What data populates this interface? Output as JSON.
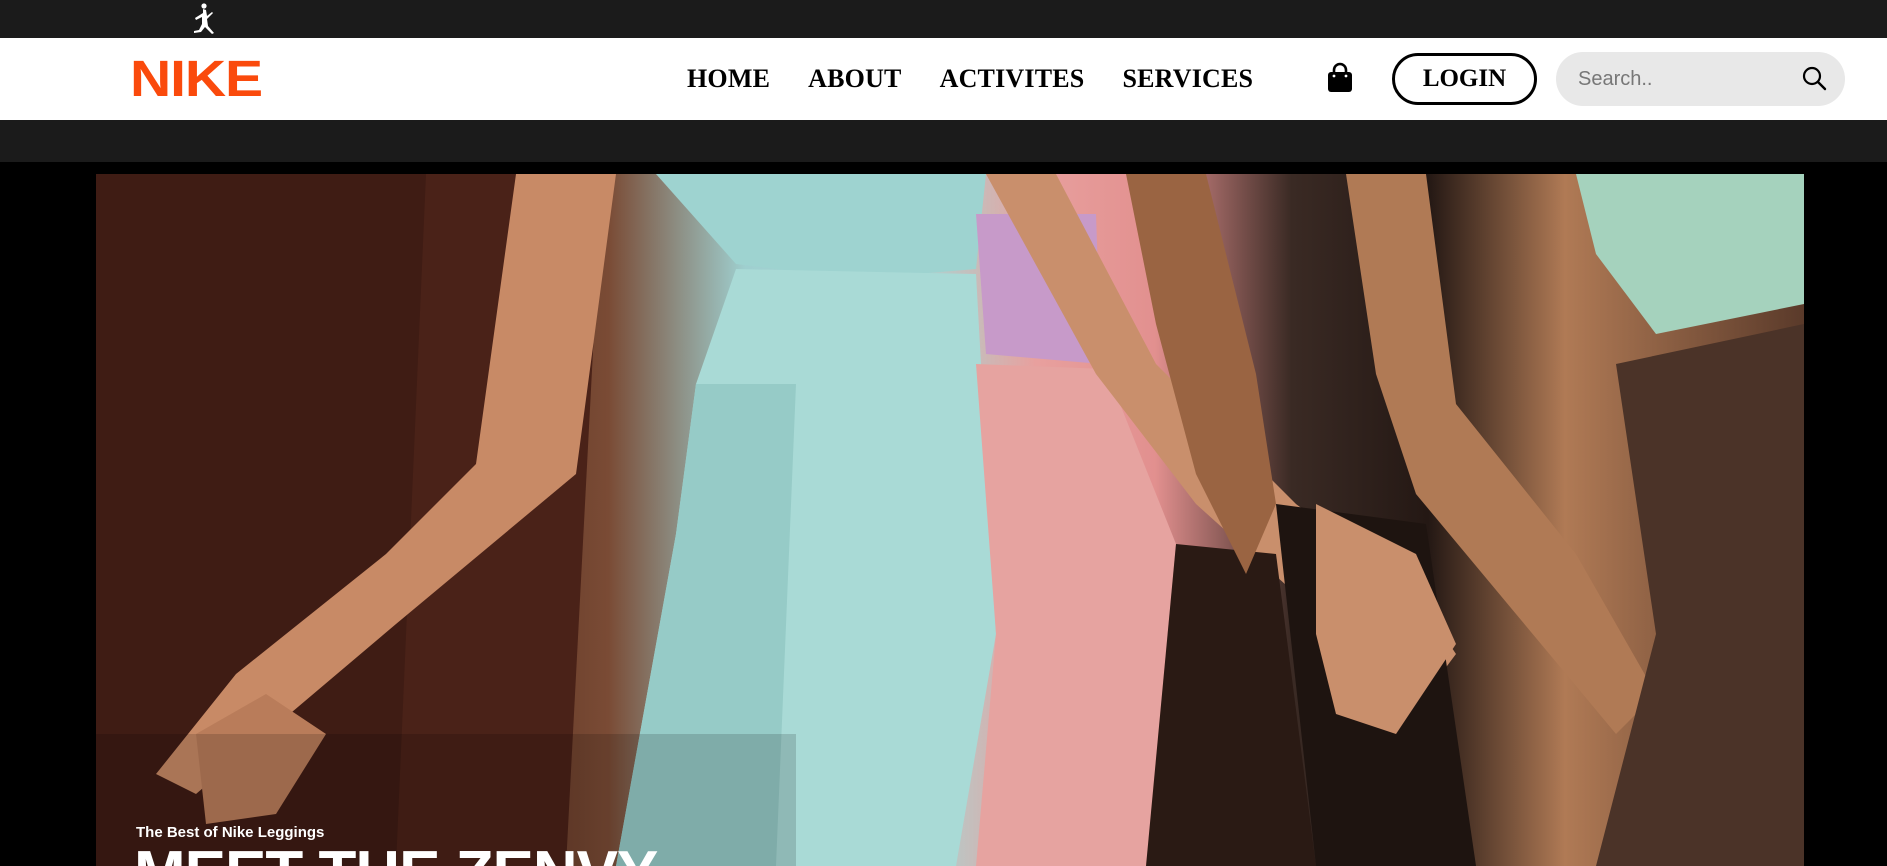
{
  "header": {
    "brand_logo": "NIKE",
    "nav": [
      "HOME",
      "ABOUT",
      "ACTIVITES",
      "SERVICES"
    ],
    "login_label": "LOGIN",
    "search_placeholder": "Search.."
  },
  "hero": {
    "eyebrow": "The Best of Nike Leggings",
    "headline": "MEET THE ZENVY"
  },
  "colors": {
    "brand": "#fa4a0c",
    "topbar": "#1b1b1b",
    "search_bg": "#e8e8e8"
  },
  "icons": [
    "jumpman-icon",
    "shopping-bag-icon",
    "search-icon"
  ]
}
